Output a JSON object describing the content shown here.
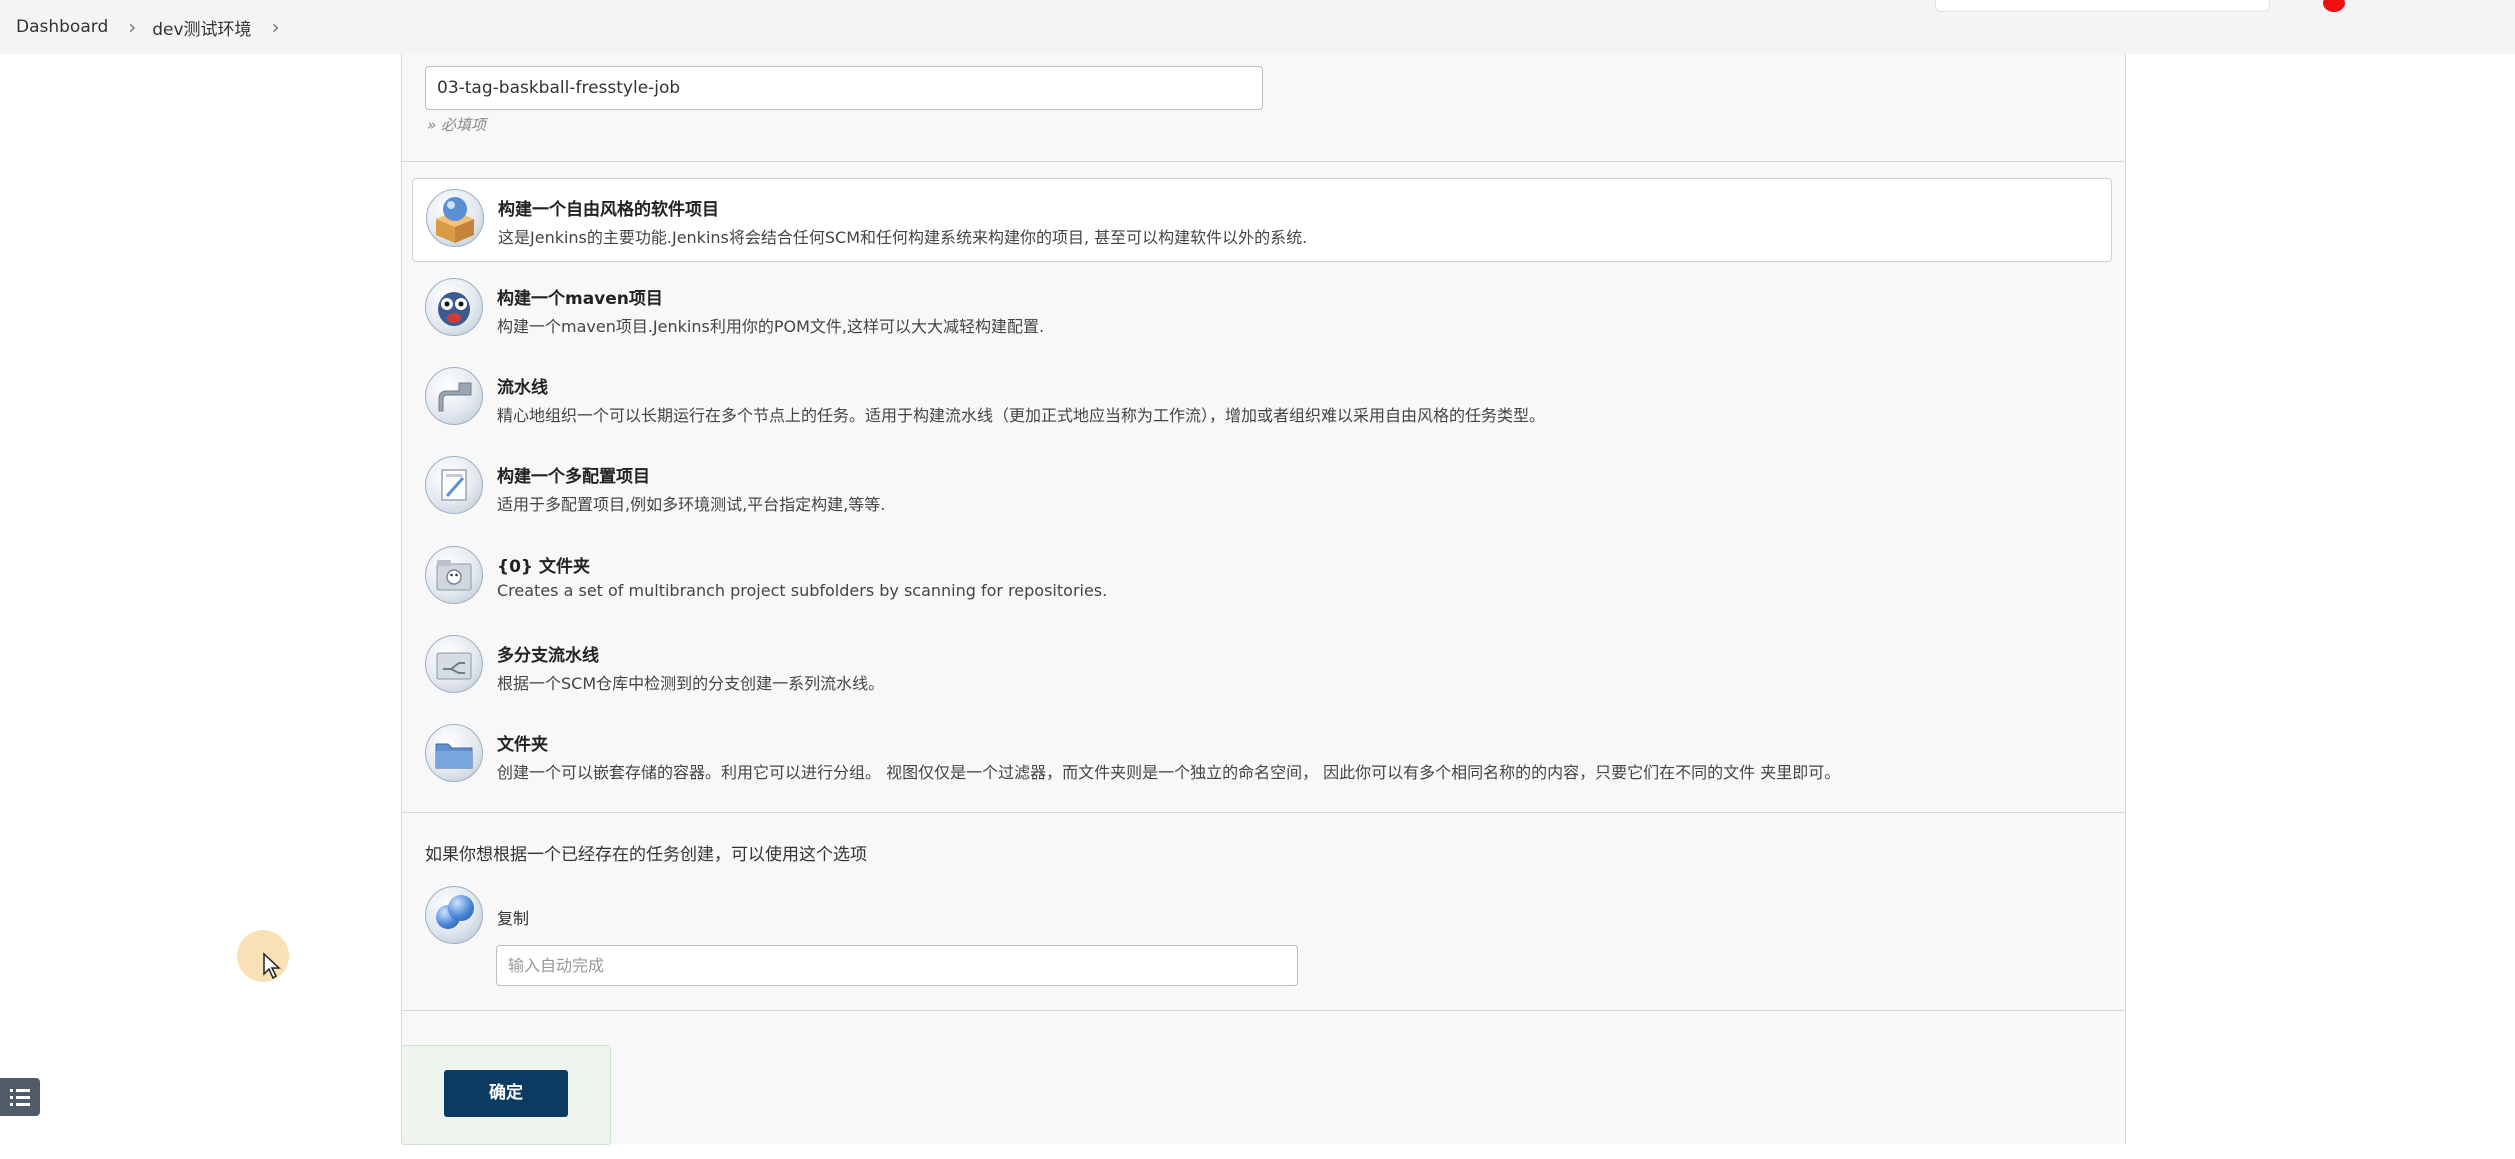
{
  "breadcrumb": {
    "items": [
      "Dashboard",
      "dev测试环境"
    ],
    "separator": "›"
  },
  "form": {
    "item_name_value": "03-tag-baskball-fresstyle-job",
    "required_hint": "» 必填项"
  },
  "job_types": [
    {
      "title": "构建一个自由风格的软件项目",
      "description": "这是Jenkins的主要功能.Jenkins将会结合任何SCM和任何构建系统来构建你的项目, 甚至可以构建软件以外的系统.",
      "icon": "freestyle-box-icon",
      "selected": true
    },
    {
      "title": "构建一个maven项目",
      "description": "构建一个maven项目.Jenkins利用你的POM文件,这样可以大大减轻构建配置.",
      "icon": "maven-owl-icon",
      "selected": false
    },
    {
      "title": "流水线",
      "description": "精心地组织一个可以长期运行在多个节点上的任务。适用于构建流水线（更加正式地应当称为工作流），增加或者组织难以采用自由风格的任务类型。",
      "icon": "pipeline-icon",
      "selected": false
    },
    {
      "title": "构建一个多配置项目",
      "description": "适用于多配置项目,例如多环境测试,平台指定构建,等等.",
      "icon": "multi-config-icon",
      "selected": false
    },
    {
      "title": "{0} 文件夹",
      "description": "Creates a set of multibranch project subfolders by scanning for repositories.",
      "icon": "org-folder-icon",
      "selected": false
    },
    {
      "title": "多分支流水线",
      "description": "根据一个SCM仓库中检测到的分支创建一系列流水线。",
      "icon": "multibranch-pipeline-icon",
      "selected": false
    },
    {
      "title": "文件夹",
      "description": "创建一个可以嵌套存储的容器。利用它可以进行分组。 视图仅仅是一个过滤器，而文件夹则是一个独立的命名空间， 因此你可以有多个相同名称的的内容，只要它们在不同的文件 夹里即可。",
      "icon": "folder-icon",
      "selected": false
    }
  ],
  "copy": {
    "prompt": "如果你想根据一个已经存在的任务创建，可以使用这个选项",
    "label": "复制",
    "placeholder": "输入自动完成"
  },
  "actions": {
    "ok_label": "确定"
  },
  "colors": {
    "ok_button": "#0b3a62",
    "panel_background": "#f8f8f8",
    "topbar_background": "#f3f4f6"
  }
}
